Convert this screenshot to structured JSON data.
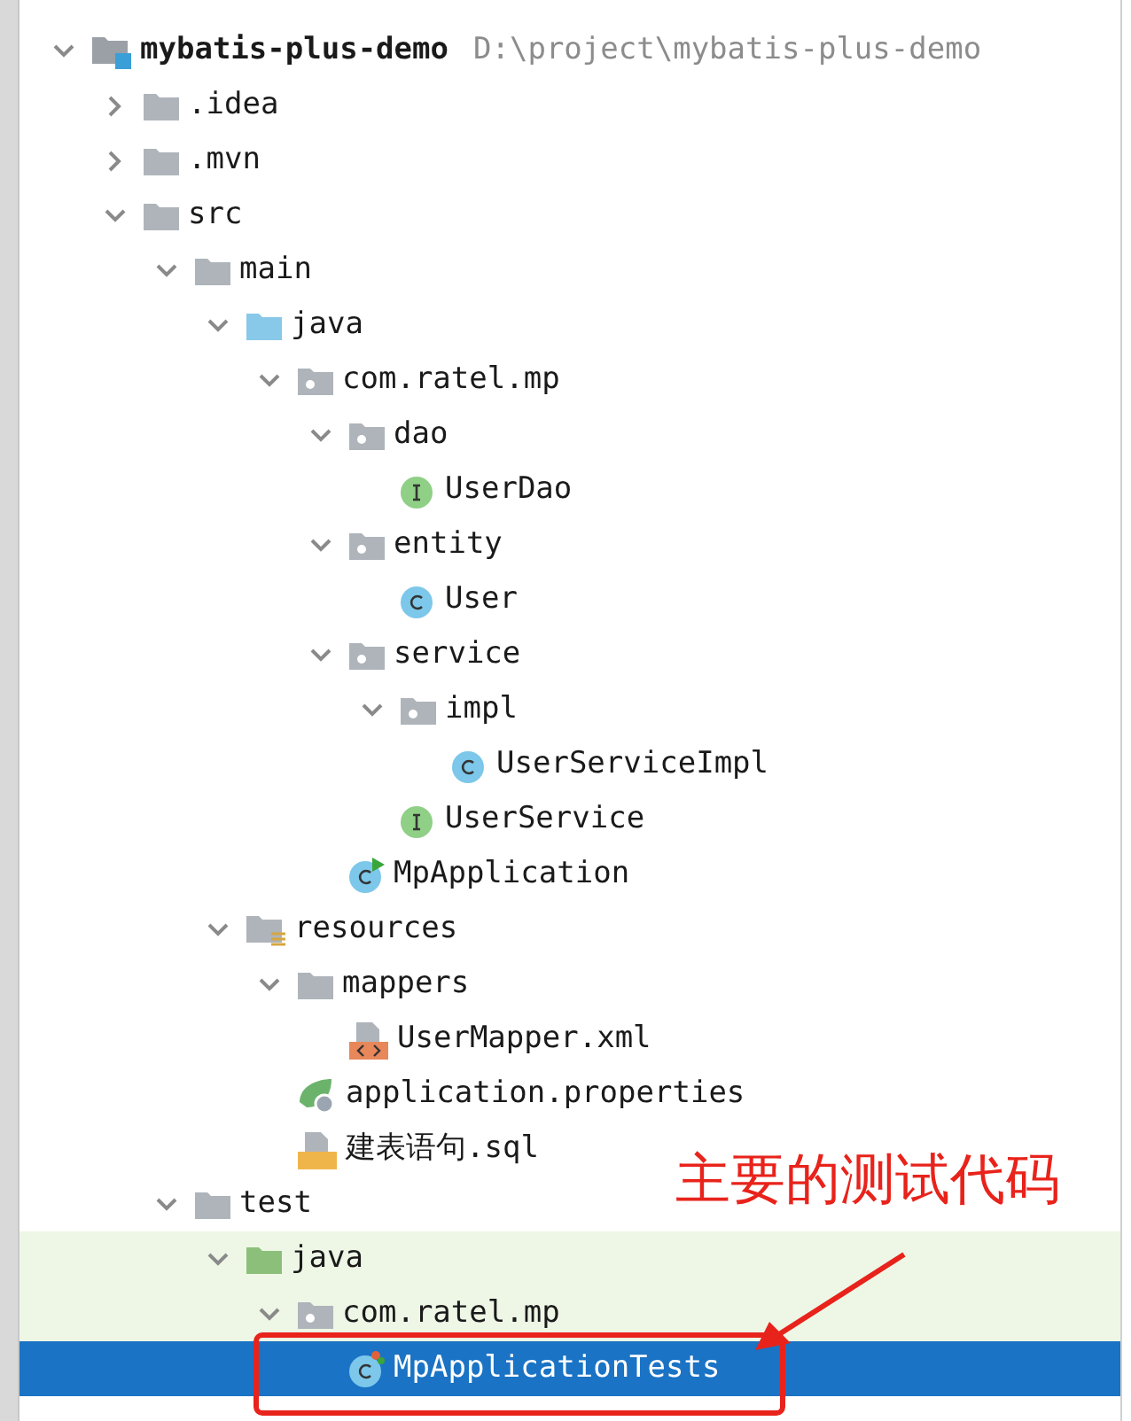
{
  "project_tree": [
    {
      "kind": "module",
      "label": "mybatis-plus-demo",
      "path": "D:\\project\\mybatis-plus-demo",
      "expanded": true,
      "selected": false,
      "highlighted": false,
      "children": [
        {
          "kind": "folder",
          "label": ".idea",
          "expanded": false,
          "selected": false,
          "highlighted": false
        },
        {
          "kind": "folder",
          "label": ".mvn",
          "expanded": false,
          "selected": false,
          "highlighted": false
        },
        {
          "kind": "folder",
          "label": "src",
          "expanded": true,
          "selected": false,
          "highlighted": false,
          "children": [
            {
              "kind": "folder",
              "label": "main",
              "expanded": true,
              "selected": false,
              "highlighted": false,
              "children": [
                {
                  "kind": "source-folder",
                  "label": "java",
                  "expanded": true,
                  "selected": false,
                  "highlighted": false,
                  "children": [
                    {
                      "kind": "package",
                      "label": "com.ratel.mp",
                      "expanded": true,
                      "selected": false,
                      "highlighted": false,
                      "children": [
                        {
                          "kind": "package",
                          "label": "dao",
                          "expanded": true,
                          "selected": false,
                          "highlighted": false,
                          "children": [
                            {
                              "kind": "interface",
                              "label": "UserDao",
                              "selected": false,
                              "highlighted": false
                            }
                          ]
                        },
                        {
                          "kind": "package",
                          "label": "entity",
                          "expanded": true,
                          "selected": false,
                          "highlighted": false,
                          "children": [
                            {
                              "kind": "class",
                              "label": "User",
                              "selected": false,
                              "highlighted": false
                            }
                          ]
                        },
                        {
                          "kind": "package",
                          "label": "service",
                          "expanded": true,
                          "selected": false,
                          "highlighted": false,
                          "children": [
                            {
                              "kind": "package",
                              "label": "impl",
                              "expanded": true,
                              "selected": false,
                              "highlighted": false,
                              "children": [
                                {
                                  "kind": "class",
                                  "label": "UserServiceImpl",
                                  "selected": false,
                                  "highlighted": false
                                }
                              ]
                            },
                            {
                              "kind": "interface",
                              "label": "UserService",
                              "selected": false,
                              "highlighted": false
                            }
                          ]
                        },
                        {
                          "kind": "app-class",
                          "label": "MpApplication",
                          "selected": false,
                          "highlighted": false
                        }
                      ]
                    }
                  ]
                },
                {
                  "kind": "resources-folder",
                  "label": "resources",
                  "expanded": true,
                  "selected": false,
                  "highlighted": false,
                  "children": [
                    {
                      "kind": "folder",
                      "label": "mappers",
                      "expanded": true,
                      "selected": false,
                      "highlighted": false,
                      "children": [
                        {
                          "kind": "xml",
                          "label": "UserMapper.xml",
                          "selected": false,
                          "highlighted": false
                        }
                      ]
                    },
                    {
                      "kind": "properties",
                      "label": "application.properties",
                      "selected": false,
                      "highlighted": false
                    },
                    {
                      "kind": "sql",
                      "label": "建表语句.sql",
                      "selected": false,
                      "highlighted": false
                    }
                  ]
                }
              ]
            },
            {
              "kind": "folder",
              "label": "test",
              "expanded": true,
              "selected": false,
              "highlighted": false,
              "children": [
                {
                  "kind": "test-folder",
                  "label": "java",
                  "expanded": true,
                  "selected": false,
                  "highlighted": true,
                  "children": [
                    {
                      "kind": "package",
                      "label": "com.ratel.mp",
                      "expanded": true,
                      "selected": false,
                      "highlighted": true,
                      "children": [
                        {
                          "kind": "test-class",
                          "label": "MpApplicationTests",
                          "selected": true
                        }
                      ]
                    }
                  ]
                }
              ]
            }
          ]
        }
      ]
    }
  ],
  "annotation": {
    "text": "主要的测试代码"
  }
}
